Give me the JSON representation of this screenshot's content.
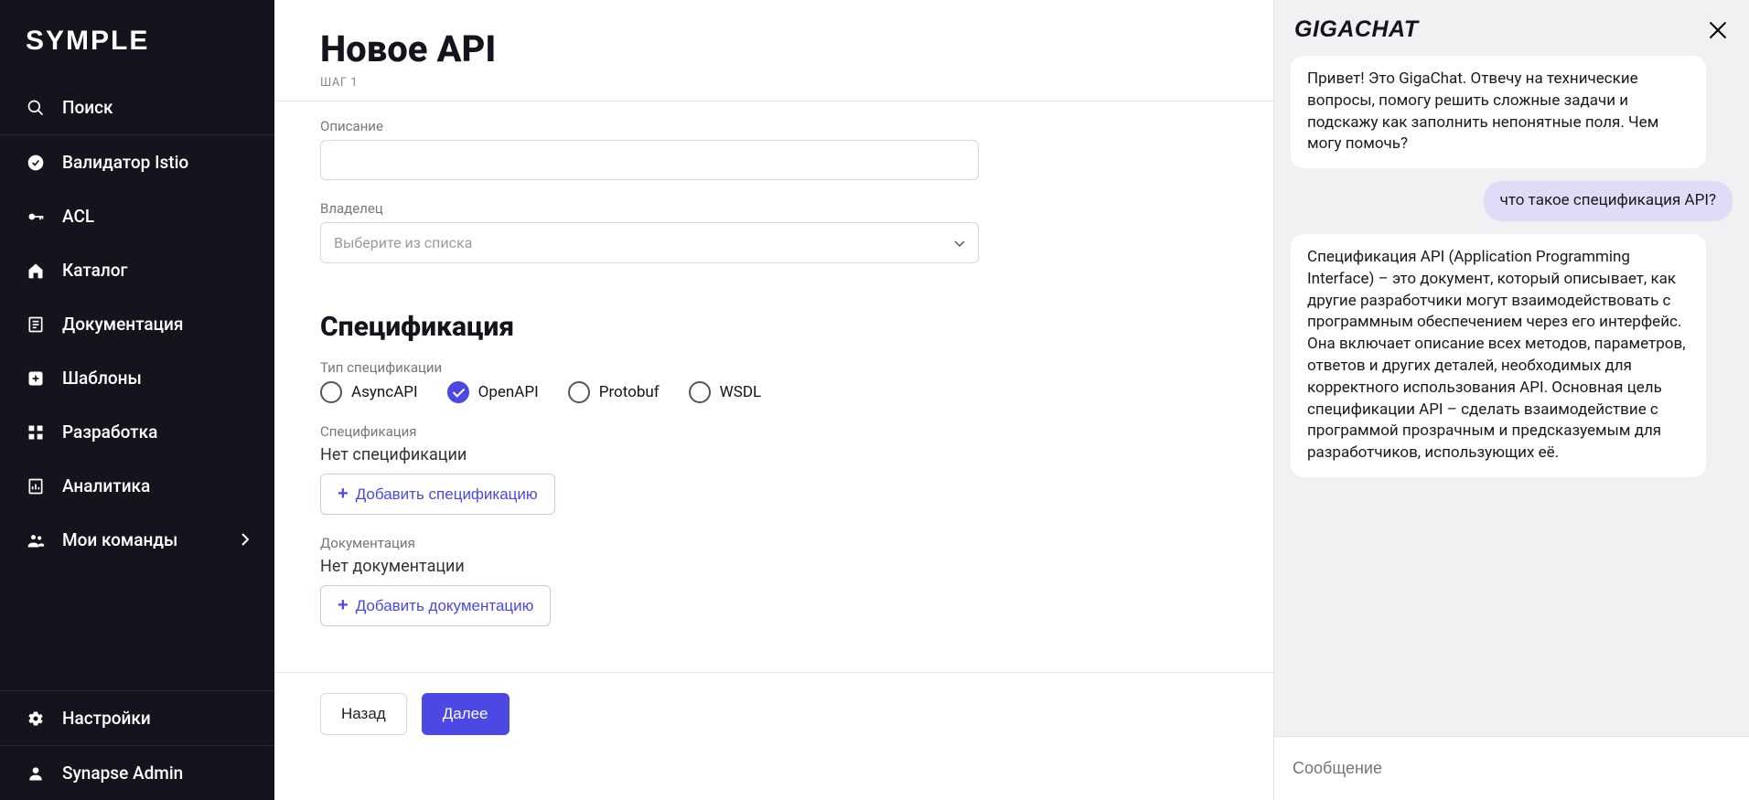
{
  "brand": "SYMPLE",
  "sidebar": {
    "search_label": "Поиск",
    "items": [
      {
        "label": "Валидатор Istio",
        "icon": "check-circle"
      },
      {
        "label": "ACL",
        "icon": "key"
      },
      {
        "label": "Каталог",
        "icon": "home"
      },
      {
        "label": "Документация",
        "icon": "doc-list"
      },
      {
        "label": "Шаблоны",
        "icon": "plus-box"
      },
      {
        "label": "Разработка",
        "icon": "grid"
      },
      {
        "label": "Аналитика",
        "icon": "report"
      },
      {
        "label": "Мои команды",
        "icon": "people",
        "chevron": true
      }
    ],
    "settings_label": "Настройки",
    "user_label": "Synapse Admin"
  },
  "page": {
    "title": "Новое API",
    "step_label": "ШАГ 1",
    "desc_label": "Описание",
    "owner_label": "Владелец",
    "owner_placeholder": "Выберите из списка",
    "spec_heading": "Спецификация",
    "spec_type_label": "Тип спецификации",
    "radios": [
      {
        "label": "AsyncAPI",
        "checked": false
      },
      {
        "label": "OpenAPI",
        "checked": true
      },
      {
        "label": "Protobuf",
        "checked": false
      },
      {
        "label": "WSDL",
        "checked": false
      }
    ],
    "spec_label": "Спецификация",
    "spec_empty": "Нет спецификации",
    "add_spec_label": "Добавить спецификацию",
    "doc_label": "Документация",
    "doc_empty": "Нет документации",
    "add_doc_label": "Добавить документацию",
    "back_label": "Назад",
    "next_label": "Далее"
  },
  "chat": {
    "title": "GIGACHAT",
    "messages": [
      {
        "role": "bot",
        "text": "Привет! Это GigaChat. Отвечу на технические вопросы, помогу решить сложные задачи и подскажу как заполнить непонятные поля. Чем могу помочь?"
      },
      {
        "role": "user",
        "text": "что такое спецификация API?"
      },
      {
        "role": "bot",
        "text": "Спецификация API (Application Programming Interface) – это документ, который описывает, как другие разработчики могут взаимодействовать с программным обеспечением через его интерфейс. Она включает описание всех методов, параметров, ответов и других деталей, необходимых для корректного использования API. Основная цель спецификации API – сделать взаимодействие с программой прозрачным и предсказуемым для разработчиков, использующих её."
      }
    ],
    "input_placeholder": "Сообщение"
  }
}
